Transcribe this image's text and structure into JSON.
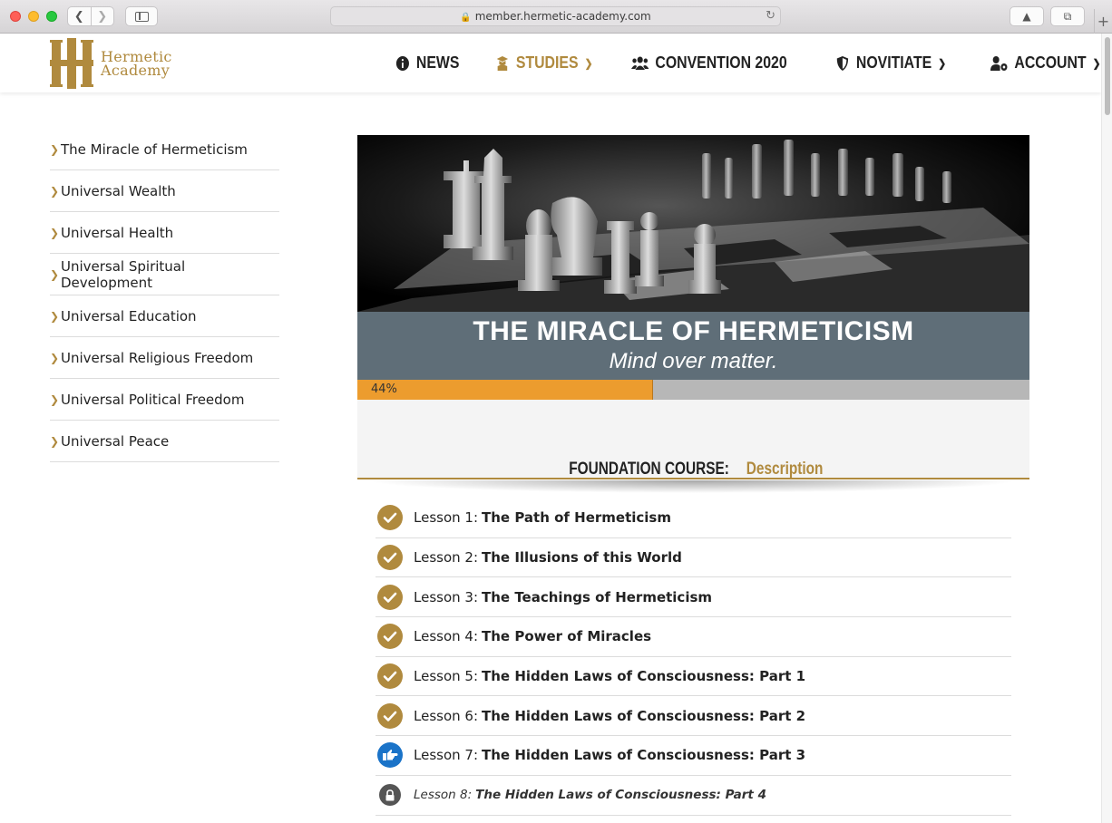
{
  "browser": {
    "url": "member.hermetic-academy.com"
  },
  "logo": {
    "line1": "Hermetic",
    "line2": "Academy"
  },
  "nav": [
    {
      "label": "NEWS",
      "icon": "info-circle-icon"
    },
    {
      "label": "STUDIES",
      "icon": "graduate-cap-icon",
      "active": true
    },
    {
      "label": "CONVENTION 2020",
      "icon": "users-icon"
    },
    {
      "label": "NOVITIATE",
      "icon": "shield-icon"
    },
    {
      "label": "ACCOUNT",
      "icon": "user-cog-icon"
    }
  ],
  "sidebar": {
    "items": [
      {
        "label": "The Miracle of Hermeticism"
      },
      {
        "label": "Universal Wealth"
      },
      {
        "label": "Universal Health"
      },
      {
        "label": "Universal Spiritual Development"
      },
      {
        "label": "Universal Education"
      },
      {
        "label": "Universal Religious Freedom"
      },
      {
        "label": "Universal Political Freedom"
      },
      {
        "label": "Universal Peace"
      }
    ]
  },
  "banner": {
    "title": "THE MIRACLE OF HERMETICISM",
    "subtitle": "Mind over matter."
  },
  "progress": {
    "label": "44%",
    "fraction": 0.44
  },
  "description": {
    "prefix": "FOUNDATION COURSE:",
    "link": "Description"
  },
  "lessons": [
    {
      "prefix": "Lesson 1:",
      "title": "The Path of Hermeticism",
      "status": "done"
    },
    {
      "prefix": "Lesson 2:",
      "title": "The Illusions of this World",
      "status": "done"
    },
    {
      "prefix": "Lesson 3:",
      "title": "The Teachings of Hermeticism",
      "status": "done"
    },
    {
      "prefix": "Lesson 4:",
      "title": "The Power of Miracles",
      "status": "done"
    },
    {
      "prefix": "Lesson 5:",
      "title": "The Hidden Laws of Consciousness: Part 1",
      "status": "done"
    },
    {
      "prefix": "Lesson 6:",
      "title": "The Hidden Laws of Consciousness: Part 2",
      "status": "done"
    },
    {
      "prefix": "Lesson 7:",
      "title": "The Hidden Laws of Consciousness: Part 3",
      "status": "current"
    },
    {
      "prefix": "Lesson 8:",
      "title": "The Hidden Laws of Consciousness: Part 4",
      "status": "locked"
    }
  ],
  "colors": {
    "accent": "#b08a3e",
    "progress": "#ec9c2e",
    "current": "#1a73c8"
  }
}
